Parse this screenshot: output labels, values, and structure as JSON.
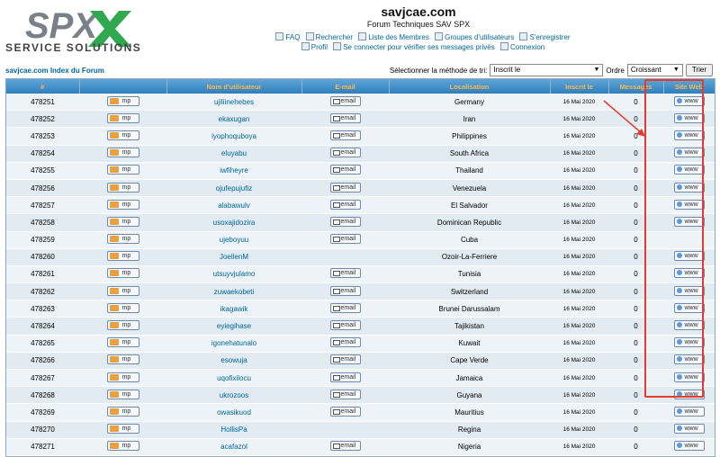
{
  "logo": {
    "brand": "SPX",
    "tagline": "SERVICE SOLUTIONS"
  },
  "header": {
    "site_title": "savjcae.com",
    "site_subtitle": "Forum Techniques SAV SPX"
  },
  "nav": {
    "row1": [
      "FAQ",
      "Rechercher",
      "Liste des Membres",
      "Groupes d'utilisateurs",
      "S'enregistrer"
    ],
    "row2": [
      "Profil",
      "Se connecter pour vérifier ses messages privés",
      "Connexion"
    ]
  },
  "breadcrumb": "savjcae.com Index du Forum",
  "sort": {
    "label": "Sélectionner la méthode de tri:",
    "method": "Inscrit le",
    "order_label": "Ordre",
    "order": "Croissant",
    "button": "Trier"
  },
  "table": {
    "headers": [
      "#",
      "",
      "Nom d'utilisateur",
      "E-mail",
      "Localisation",
      "Inscrit le",
      "Messages",
      "Site Web"
    ],
    "pm_label": "mp",
    "email_label": "email",
    "www_label": "www",
    "rows": [
      {
        "id": "478251",
        "user": "ujiliinehebes",
        "email": true,
        "loc": "Germany",
        "date": "16 Mai 2020",
        "msgs": "0",
        "www": true
      },
      {
        "id": "478252",
        "user": "ekaxugan",
        "email": true,
        "loc": "Iran",
        "date": "16 Mai 2020",
        "msgs": "0",
        "www": true
      },
      {
        "id": "478253",
        "user": "iyophoquboya",
        "email": true,
        "loc": "Philippines",
        "date": "16 Mai 2020",
        "msgs": "0",
        "www": true
      },
      {
        "id": "478254",
        "user": "eluyabu",
        "email": true,
        "loc": "South Africa",
        "date": "16 Mai 2020",
        "msgs": "0",
        "www": true
      },
      {
        "id": "478255",
        "user": "iwfiheyre",
        "email": true,
        "loc": "Thailand",
        "date": "16 Mai 2020",
        "msgs": "0",
        "www": true
      },
      {
        "id": "478256",
        "user": "ojufepujufiz",
        "email": true,
        "loc": "Venezuela",
        "date": "16 Mai 2020",
        "msgs": "0",
        "www": true
      },
      {
        "id": "478257",
        "user": "alabawulv",
        "email": true,
        "loc": "El Salvador",
        "date": "16 Mai 2020",
        "msgs": "0",
        "www": true
      },
      {
        "id": "478258",
        "user": "usoxajidozira",
        "email": true,
        "loc": "Dominican Republic",
        "date": "16 Mai 2020",
        "msgs": "0",
        "www": true
      },
      {
        "id": "478259",
        "user": "ujeboyuu",
        "email": true,
        "loc": "Cuba",
        "date": "16 Mai 2020",
        "msgs": "0",
        "www": false
      },
      {
        "id": "478260",
        "user": "JoellenM",
        "email": false,
        "loc": "Ozoir-La-Ferriere",
        "date": "16 Mai 2020",
        "msgs": "0",
        "www": true
      },
      {
        "id": "478261",
        "user": "utsuyvjulamo",
        "email": true,
        "loc": "Tunisia",
        "date": "16 Mai 2020",
        "msgs": "0",
        "www": true
      },
      {
        "id": "478262",
        "user": "zuwaekobeti",
        "email": true,
        "loc": "Switzerland",
        "date": "16 Mai 2020",
        "msgs": "0",
        "www": true
      },
      {
        "id": "478263",
        "user": "ikagawik",
        "email": true,
        "loc": "Brunei Darussalam",
        "date": "16 Mai 2020",
        "msgs": "0",
        "www": true
      },
      {
        "id": "478264",
        "user": "eyiegihase",
        "email": true,
        "loc": "Tajikistan",
        "date": "16 Mai 2020",
        "msgs": "0",
        "www": true
      },
      {
        "id": "478265",
        "user": "igonehatunalo",
        "email": true,
        "loc": "Kuwait",
        "date": "16 Mai 2020",
        "msgs": "0",
        "www": true
      },
      {
        "id": "478266",
        "user": "esowuja",
        "email": true,
        "loc": "Cape Verde",
        "date": "16 Mai 2020",
        "msgs": "0",
        "www": true
      },
      {
        "id": "478267",
        "user": "uqofixilocu",
        "email": true,
        "loc": "Jamaica",
        "date": "16 Mai 2020",
        "msgs": "0",
        "www": true
      },
      {
        "id": "478268",
        "user": "ukrozoos",
        "email": true,
        "loc": "Guyana",
        "date": "16 Mai 2020",
        "msgs": "0",
        "www": true
      },
      {
        "id": "478269",
        "user": "owasikuod",
        "email": true,
        "loc": "Mauritius",
        "date": "16 Mai 2020",
        "msgs": "0",
        "www": true
      },
      {
        "id": "478270",
        "user": "HollisPa",
        "email": false,
        "loc": "Regina",
        "date": "16 Mai 2020",
        "msgs": "0",
        "www": true
      },
      {
        "id": "478271",
        "user": "acafazol",
        "email": true,
        "loc": "Nigeria",
        "date": "16 Mai 2020",
        "msgs": "0",
        "www": true
      }
    ]
  },
  "colors": {
    "header_bg": "#3d8ec8",
    "header_text": "#ffb84d",
    "link": "#006699",
    "highlight": "#e53a2e",
    "row_odd": "#eef3f8",
    "row_even": "#e2eaf2"
  }
}
